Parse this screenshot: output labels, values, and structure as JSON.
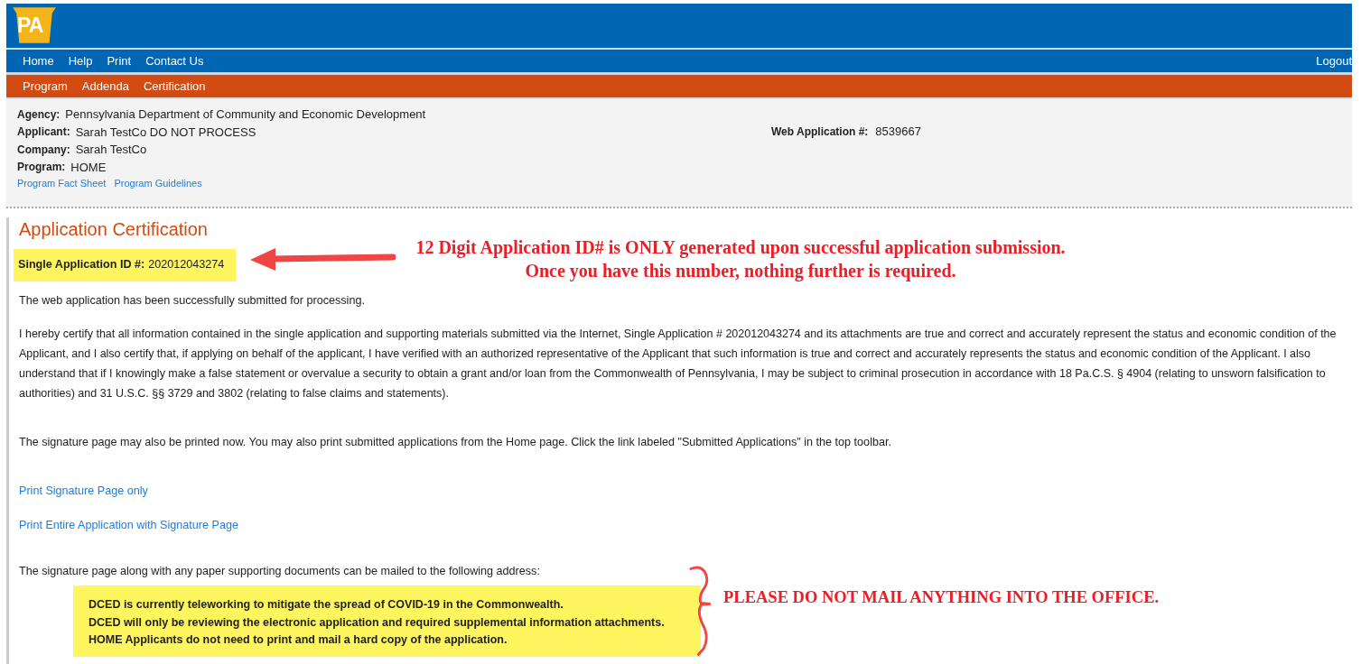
{
  "header": {
    "logo": "PA"
  },
  "top_nav": {
    "items": [
      "Home",
      "Help",
      "Print",
      "Contact Us"
    ],
    "logout": "Logout"
  },
  "sub_nav": {
    "items": [
      "Program",
      "Addenda",
      "Certification"
    ]
  },
  "info": {
    "fields": [
      {
        "label": "Agency:",
        "value": "Pennsylvania Department of Community and Economic Development"
      },
      {
        "label": "Applicant:",
        "value": "Sarah TestCo DO NOT PROCESS"
      },
      {
        "label": "Company:",
        "value": "Sarah TestCo"
      },
      {
        "label": "Program:",
        "value": "HOME"
      }
    ],
    "web_app": {
      "label": "Web Application #:",
      "value": "8539667"
    },
    "links": [
      "Program Fact Sheet",
      "Program Guidelines"
    ]
  },
  "content": {
    "title": "Application Certification",
    "id_label": "Single Application ID #:",
    "id_value": "202012043274",
    "submitted": "The web application has been successfully submitted for processing.",
    "certify": "I hereby certify that all information contained in the single application and supporting materials submitted via the Internet, Single Application # 202012043274  and its attachments are true and correct and accurately represent the status and economic condition of the Applicant, and I also certify that, if applying on behalf of the applicant, I have verified with an authorized representative of the Applicant that such information is true and correct and accurately represents the status and economic condition of the Applicant.  I also understand that if I knowingly make a false statement or overvalue a security to obtain a grant and/or loan from the Commonwealth of Pennsylvania, I may be subject to criminal prosecution in accordance with 18 Pa.C.S. § 4904 (relating to unsworn falsification to authorities) and 31 U.S.C. §§ 3729 and 3802 (relating to false claims and statements).",
    "print_note": "The signature page may also be printed now.  You may also print submitted applications from the Home page.  Click the link labeled \"Submitted Applications\" in the top toolbar.",
    "print_links": [
      "Print Signature Page only",
      "Print Entire Application with Signature Page"
    ],
    "mail_note": "The signature page along with any paper supporting documents can be mailed to the following address:",
    "notice_lines": [
      "DCED is currently teleworking to mitigate the spread of COVID-19 in the Commonwealth.",
      "DCED will only be reviewing the electronic application and required supplemental information attachments.",
      "HOME Applicants do not need to print and mail a hard copy of the application."
    ]
  },
  "annotations": {
    "id_note": "12 Digit Application ID# is ONLY generated upon successful application submission.  Once you have this number, nothing further is required.",
    "mail_note": "PLEASE DO NOT MAIL ANYTHING INTO THE OFFICE."
  }
}
